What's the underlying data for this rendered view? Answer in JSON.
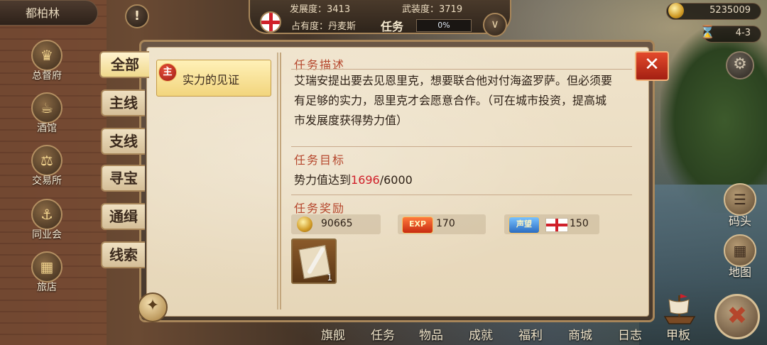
{
  "city": {
    "name": "都柏林"
  },
  "header": {
    "development_label": "发展度：",
    "development_value": "3413",
    "armament_label": "武装度：",
    "armament_value": "3719",
    "occupancy_label": "占有度：丹麦斯",
    "task_label": "任务",
    "task_progress_text": "0%",
    "task_progress": 0.0
  },
  "resources": {
    "gold": "5235009",
    "date": "4-3"
  },
  "left_nav": [
    {
      "label": "总督府",
      "icon": "crown-icon"
    },
    {
      "label": "酒馆",
      "icon": "beer-mug-icon"
    },
    {
      "label": "交易所",
      "icon": "scales-icon"
    },
    {
      "label": "同业会",
      "icon": "anchor-icon"
    },
    {
      "label": "旅店",
      "icon": "inn-basket-icon"
    }
  ],
  "tabs": [
    {
      "label": "全部",
      "active": true
    },
    {
      "label": "主线",
      "active": false
    },
    {
      "label": "支线",
      "active": false
    },
    {
      "label": "寻宝",
      "active": false
    },
    {
      "label": "通缉",
      "active": false
    },
    {
      "label": "线索",
      "active": false
    }
  ],
  "quest_list": [
    {
      "badge": "主",
      "title": "实力的见证"
    }
  ],
  "detail": {
    "description_heading": "任务描述",
    "description": "艾瑞安提出要去见恩里克，想要联合他对付海盗罗萨。但必须要有足够的实力，恩里克才会愿意合作。（可在城市投资，提高城市发展度获得势力值）",
    "goal_heading": "任务目标",
    "goal_prefix": "势力值达到",
    "goal_current": "1696",
    "goal_target": "/6000",
    "reward_heading": "任务奖励",
    "rewards": [
      {
        "type": "gold",
        "value": "90665"
      },
      {
        "type": "exp",
        "badge": "EXP",
        "value": "170"
      },
      {
        "type": "fame",
        "badge": "声望",
        "value": "150"
      }
    ],
    "item_qty": "1"
  },
  "bottom_nav": [
    {
      "label": "旗舰"
    },
    {
      "label": "任务"
    },
    {
      "label": "物品"
    },
    {
      "label": "成就"
    },
    {
      "label": "福利"
    },
    {
      "label": "商城"
    },
    {
      "label": "日志"
    },
    {
      "label": "甲板"
    }
  ],
  "right_tools": [
    {
      "label": "码头",
      "icon": "dock-icon"
    },
    {
      "label": "地图",
      "icon": "map-scroll-icon"
    }
  ],
  "colors": {
    "accent_red": "#d0202a",
    "gold": "#a8865a",
    "paper": "#efe3cb"
  }
}
